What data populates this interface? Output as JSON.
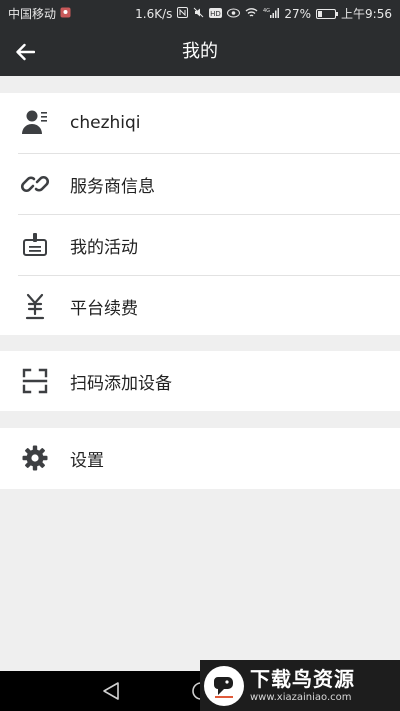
{
  "status_bar": {
    "carrier": "中国移动",
    "speed": "1.6K/s",
    "network": "4G",
    "battery": "27%",
    "battery_level": 0.27,
    "time": "上午9:56"
  },
  "header": {
    "title": "我的",
    "back_icon": "arrow-left-icon"
  },
  "menu_groups": [
    {
      "items": [
        {
          "label": "chezhiqi",
          "icon": "user-profile-icon"
        },
        {
          "label": "服务商信息",
          "icon": "link-icon"
        },
        {
          "label": "我的活动",
          "icon": "activity-badge-icon"
        },
        {
          "label": "平台续费",
          "icon": "yen-icon"
        }
      ]
    },
    {
      "items": [
        {
          "label": "扫码添加设备",
          "icon": "scan-icon"
        }
      ]
    },
    {
      "items": [
        {
          "label": "设置",
          "icon": "gear-icon"
        }
      ]
    }
  ],
  "watermark": {
    "title": "下载鸟资源",
    "url": "www.xiazainiao.com"
  },
  "colors": {
    "header_bg": "#2b2d2f",
    "page_bg": "#efefef",
    "icon": "#3d3f42"
  }
}
